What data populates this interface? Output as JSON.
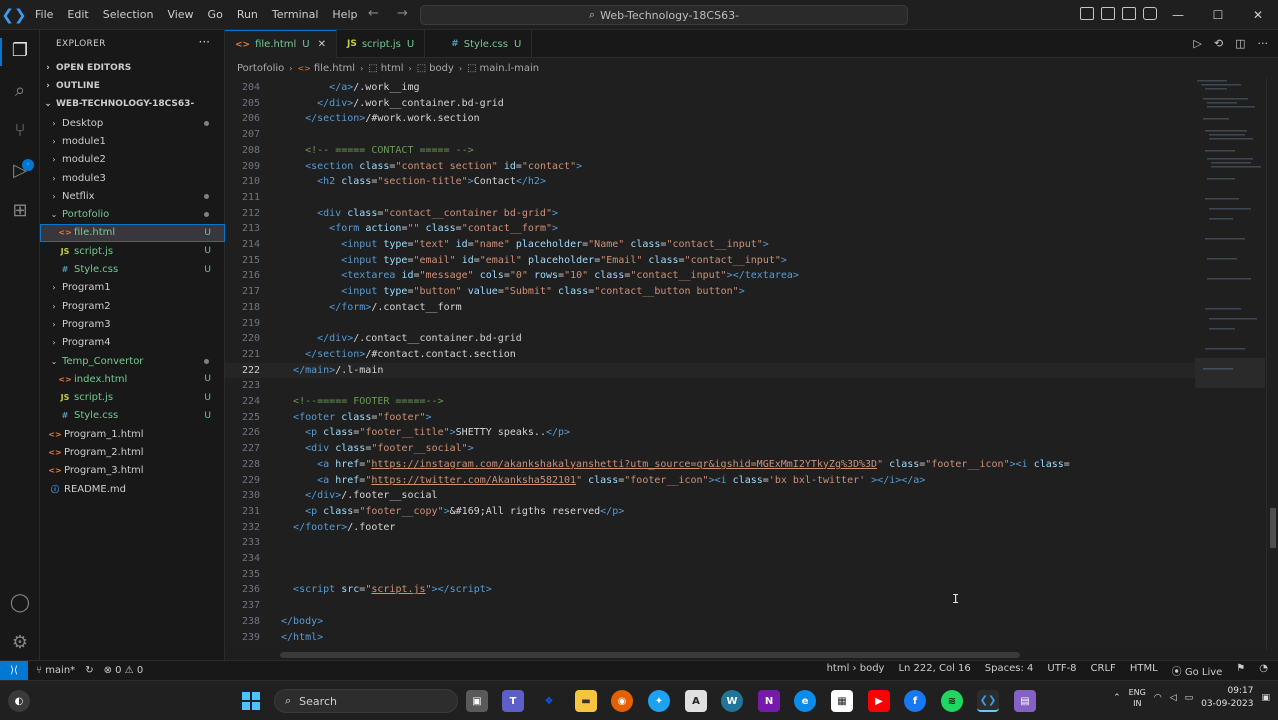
{
  "titlebar": {
    "menu": [
      "File",
      "Edit",
      "Selection",
      "View",
      "Go",
      "Run",
      "Terminal",
      "Help"
    ],
    "search_text": "Web-Technology-18CS63-",
    "back": "←",
    "forward": "→",
    "minimize": "—",
    "maximize": "☐",
    "close": "✕"
  },
  "sidebar": {
    "title": "EXPLORER",
    "more": "···",
    "open_editors": "OPEN EDITORS",
    "outline": "OUTLINE",
    "workspace": "WEB-TECHNOLOGY-18CS63-",
    "items": [
      {
        "label": "Desktop",
        "type": "folder",
        "depth": 1,
        "status": "dot"
      },
      {
        "label": "module1",
        "type": "folder",
        "depth": 1,
        "status": ""
      },
      {
        "label": "module2",
        "type": "folder",
        "depth": 1,
        "status": ""
      },
      {
        "label": "module3",
        "type": "folder",
        "depth": 1,
        "status": ""
      },
      {
        "label": "Netflix",
        "type": "folder",
        "depth": 1,
        "status": "dot"
      },
      {
        "label": "Portofolio",
        "type": "folder-open",
        "depth": 1,
        "status": "dot",
        "green": true
      },
      {
        "label": "file.html",
        "type": "html",
        "depth": 2,
        "status": "U",
        "green": true,
        "selected": true
      },
      {
        "label": "script.js",
        "type": "js",
        "depth": 2,
        "status": "U",
        "green": true
      },
      {
        "label": "Style.css",
        "type": "css",
        "depth": 2,
        "status": "U",
        "green": true
      },
      {
        "label": "Program1",
        "type": "folder",
        "depth": 1,
        "status": ""
      },
      {
        "label": "Program2",
        "type": "folder",
        "depth": 1,
        "status": ""
      },
      {
        "label": "Program3",
        "type": "folder",
        "depth": 1,
        "status": ""
      },
      {
        "label": "Program4",
        "type": "folder",
        "depth": 1,
        "status": ""
      },
      {
        "label": "Temp_Convertor",
        "type": "folder-open",
        "depth": 1,
        "status": "dot",
        "green": true
      },
      {
        "label": "index.html",
        "type": "html",
        "depth": 2,
        "status": "U",
        "green": true
      },
      {
        "label": "script.js",
        "type": "js",
        "depth": 2,
        "status": "U",
        "green": true
      },
      {
        "label": "Style.css",
        "type": "css",
        "depth": 2,
        "status": "U",
        "green": true
      },
      {
        "label": "Program_1.html",
        "type": "html",
        "depth": 1,
        "status": ""
      },
      {
        "label": "Program_2.html",
        "type": "html",
        "depth": 1,
        "status": ""
      },
      {
        "label": "Program_3.html",
        "type": "html",
        "depth": 1,
        "status": ""
      },
      {
        "label": "README.md",
        "type": "md",
        "depth": 1,
        "status": ""
      }
    ]
  },
  "tabs": [
    {
      "label": "file.html",
      "icon": "<>",
      "status": "U",
      "active": true
    },
    {
      "label": "script.js",
      "icon": "JS",
      "status": "U",
      "active": false
    },
    {
      "label": "Style.css",
      "icon": "#",
      "status": "U",
      "active": false
    }
  ],
  "breadcrumb": [
    "Portofolio",
    "file.html",
    "html",
    "body",
    "main.l-main"
  ],
  "code": {
    "current_line": 222,
    "lines": [
      {
        "n": 204,
        "html": "        <span class='tg'>&lt;/a&gt;</span><span class='tx2'>/.work__img</span>"
      },
      {
        "n": 205,
        "html": "      <span class='tg'>&lt;/div&gt;</span><span class='tx2'>/.work__container.bd-grid</span>"
      },
      {
        "n": 206,
        "html": "    <span class='tg'>&lt;/section&gt;</span><span class='tx2'>/#work.work.section</span>"
      },
      {
        "n": 207,
        "html": ""
      },
      {
        "n": 208,
        "html": "    <span class='cm'>&lt;!-- ===== CONTACT ===== --&gt;</span>"
      },
      {
        "n": 209,
        "html": "    <span class='tg'>&lt;section</span> <span class='at'>class</span>=<span class='st'>\"contact section\"</span> <span class='at'>id</span>=<span class='st'>\"contact\"</span><span class='tg'>&gt;</span>"
      },
      {
        "n": 210,
        "html": "      <span class='tg'>&lt;h2</span> <span class='at'>class</span>=<span class='st'>\"section-title\"</span><span class='tg'>&gt;</span><span class='tx2'>Contact</span><span class='tg'>&lt;/h2&gt;</span>"
      },
      {
        "n": 211,
        "html": ""
      },
      {
        "n": 212,
        "html": "      <span class='tg'>&lt;div</span> <span class='at'>class</span>=<span class='st'>\"contact__container bd-grid\"</span><span class='tg'>&gt;</span>"
      },
      {
        "n": 213,
        "html": "        <span class='tg'>&lt;form</span> <span class='at'>action</span>=<span class='st'>\"\"</span> <span class='at'>class</span>=<span class='st'>\"contact__form\"</span><span class='tg'>&gt;</span>"
      },
      {
        "n": 214,
        "html": "          <span class='tg'>&lt;input</span> <span class='at'>type</span>=<span class='st'>\"text\"</span> <span class='at'>id</span>=<span class='st'>\"name\"</span> <span class='at'>placeholder</span>=<span class='st'>\"Name\"</span> <span class='at'>class</span>=<span class='st'>\"contact__input\"</span><span class='tg'>&gt;</span>"
      },
      {
        "n": 215,
        "html": "          <span class='tg'>&lt;input</span> <span class='at'>type</span>=<span class='st'>\"email\"</span> <span class='at'>id</span>=<span class='st'>\"email\"</span> <span class='at'>placeholder</span>=<span class='st'>\"Email\"</span> <span class='at'>class</span>=<span class='st'>\"contact__input\"</span><span class='tg'>&gt;</span>"
      },
      {
        "n": 216,
        "html": "          <span class='tg'>&lt;textarea</span> <span class='at'>id</span>=<span class='st'>\"message\"</span> <span class='at'>cols</span>=<span class='st'>\"0\"</span> <span class='at'>rows</span>=<span class='st'>\"10\"</span> <span class='at'>class</span>=<span class='st'>\"contact__input\"</span><span class='tg'>&gt;&lt;/textarea&gt;</span>"
      },
      {
        "n": 217,
        "html": "          <span class='tg'>&lt;input</span> <span class='at'>type</span>=<span class='st'>\"button\"</span> <span class='at'>value</span>=<span class='st'>\"Submit\"</span> <span class='at'>class</span>=<span class='st'>\"contact__button button\"</span><span class='tg'>&gt;</span>"
      },
      {
        "n": 218,
        "html": "        <span class='tg'>&lt;/form&gt;</span><span class='tx2'>/.contact__form</span>"
      },
      {
        "n": 219,
        "html": ""
      },
      {
        "n": 220,
        "html": "      <span class='tg'>&lt;/div&gt;</span><span class='tx2'>/.contact__container.bd-grid</span>"
      },
      {
        "n": 221,
        "html": "    <span class='tg'>&lt;/section&gt;</span><span class='tx2'>/#contact.contact.section</span>"
      },
      {
        "n": 222,
        "html": "  <span class='tg'>&lt;/main&gt;</span><span class='tx2'>/.l-main</span>"
      },
      {
        "n": 223,
        "html": ""
      },
      {
        "n": 224,
        "html": "  <span class='cm'>&lt;!--===== FOOTER =====--&gt;</span>"
      },
      {
        "n": 225,
        "html": "  <span class='tg'>&lt;footer</span> <span class='at'>class</span>=<span class='st'>\"footer\"</span><span class='tg'>&gt;</span>"
      },
      {
        "n": 226,
        "html": "    <span class='tg'>&lt;p</span> <span class='at'>class</span>=<span class='st'>\"footer__title\"</span><span class='tg'>&gt;</span><span class='tx2'>SHETTY speaks..</span><span class='tg'>&lt;/p&gt;</span>"
      },
      {
        "n": 227,
        "html": "    <span class='tg'>&lt;div</span> <span class='at'>class</span>=<span class='st'>\"footer__social\"</span><span class='tg'>&gt;</span>"
      },
      {
        "n": 228,
        "html": "      <span class='tg'>&lt;a</span> <span class='at'>href</span>=<span class='st'>\"<span class='ul'>https://instagram.com/akankshakalyanshetti?utm_source=qr&amp;igshid=MGExMmI2YTkyZg%3D%3D</span>\"</span> <span class='at'>class</span>=<span class='st'>\"footer__icon\"</span><span class='tg'>&gt;&lt;i</span> <span class='at'>class</span>="
      },
      {
        "n": 229,
        "html": "      <span class='tg'>&lt;a</span> <span class='at'>href</span>=<span class='st'>\"<span class='ul'>https://twitter.com/Akanksha582101</span>\"</span> <span class='at'>class</span>=<span class='st'>\"footer__icon\"</span><span class='tg'>&gt;&lt;i</span> <span class='at'>class</span>=<span class='st'>'bx bxl-twitter'</span> <span class='tg'>&gt;&lt;/i&gt;&lt;/a&gt;</span>"
      },
      {
        "n": 230,
        "html": "    <span class='tg'>&lt;/div&gt;</span><span class='tx2'>/.footer__social</span>"
      },
      {
        "n": 231,
        "html": "    <span class='tg'>&lt;p</span> <span class='at'>class</span>=<span class='st'>\"footer__copy\"</span><span class='tg'>&gt;</span><span class='tx2'>&amp;#169;All rigths reserved</span><span class='tg'>&lt;/p&gt;</span>"
      },
      {
        "n": 232,
        "html": "  <span class='tg'>&lt;/footer&gt;</span><span class='tx2'>/.footer</span>"
      },
      {
        "n": 233,
        "html": ""
      },
      {
        "n": 234,
        "html": ""
      },
      {
        "n": 235,
        "html": ""
      },
      {
        "n": 236,
        "html": "  <span class='tg'>&lt;script</span> <span class='at'>src</span>=<span class='st'>\"<span class='ul'>script.js</span>\"</span><span class='tg'>&gt;&lt;/script&gt;</span>"
      },
      {
        "n": 237,
        "html": ""
      },
      {
        "n": 238,
        "html": "<span class='tg'>&lt;/body&gt;</span>"
      },
      {
        "n": 239,
        "html": "<span class='tg'>&lt;/html&gt;</span>"
      }
    ]
  },
  "statusbar": {
    "branch": "main*",
    "errors": "⊗ 0 ⚠ 0",
    "scope": "html › body",
    "position": "Ln 222, Col 16",
    "spaces": "Spaces: 4",
    "encoding": "UTF-8",
    "eol": "CRLF",
    "language": "HTML",
    "golive": "Go Live"
  },
  "taskbar": {
    "search_label": "Search",
    "lang_top": "ENG",
    "lang_bottom": "IN",
    "time": "09:17",
    "date": "03-09-2023"
  },
  "colors": {
    "accent": "#0078d4",
    "untracked": "#73c991"
  }
}
